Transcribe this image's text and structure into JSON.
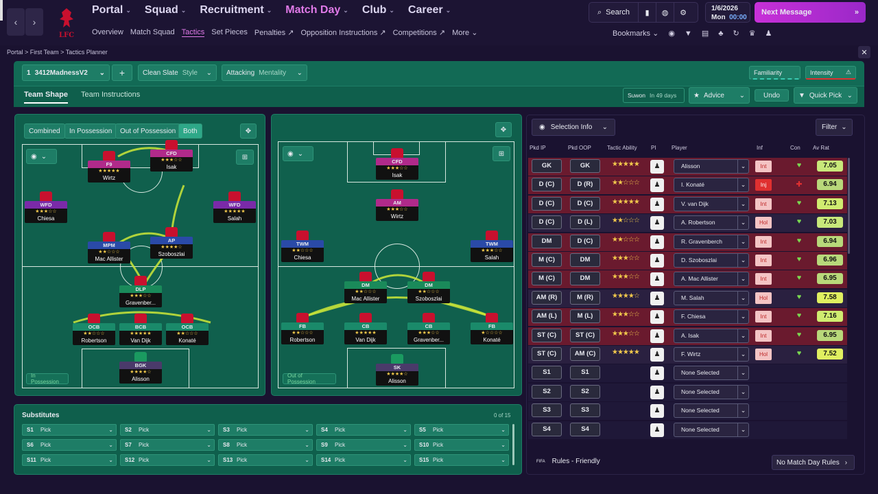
{
  "topbar": {
    "crest_text": "LFC",
    "nav": [
      {
        "label": "Portal",
        "active": false
      },
      {
        "label": "Squad",
        "active": false
      },
      {
        "label": "Recruitment",
        "active": false
      },
      {
        "label": "Match Day",
        "active": true
      },
      {
        "label": "Club",
        "active": false
      },
      {
        "label": "Career",
        "active": false
      }
    ],
    "subnav": [
      "Overview",
      "Match Squad",
      "Tactics",
      "Set Pieces",
      "Penalties",
      "Opposition Instructions",
      "Competitions",
      "More"
    ],
    "search_label": "Search",
    "date": "1/6/2026",
    "day": "Mon",
    "time": "00:00",
    "next_message": "Next Message",
    "bookmarks_label": "Bookmarks"
  },
  "breadcrumb": [
    "Portal",
    "First Team",
    "Tactics Planner"
  ],
  "tactic_bar": {
    "slot": "1",
    "tactic_name": "3412MadnessV2",
    "style_value": "Clean Slate",
    "style_label": "Style",
    "mentality_value": "Attacking",
    "mentality_label": "Mentality",
    "familiarity_label": "Familiarity",
    "intensity_label": "Intensity"
  },
  "tabs": {
    "team_shape": "Team Shape",
    "team_instructions": "Team Instructions",
    "next_match_opponent": "Suwon",
    "next_match_when": "In 49 days",
    "advice": "Advice",
    "undo": "Undo",
    "quick_pick": "Quick Pick"
  },
  "phase_toggle": [
    "Combined",
    "In Possession",
    "Out of Possession",
    "Both"
  ],
  "in_possession_label": "In Possession",
  "out_of_possession_label": "Out of Possession",
  "in_possession": [
    {
      "role": "F9",
      "stars": "★★★★★",
      "name": "Wirtz",
      "color": "#b02a8a"
    },
    {
      "role": "CFD",
      "stars": "★★★☆☆",
      "name": "Isak",
      "color": "#b02a8a"
    },
    {
      "role": "WFD",
      "stars": "★★★☆☆",
      "name": "Chiesa",
      "color": "#7a2aa8"
    },
    {
      "role": "WFD",
      "stars": "★★★★★",
      "name": "Salah",
      "color": "#7a2aa8"
    },
    {
      "role": "MPM",
      "stars": "★★☆☆☆",
      "name": "Mac Allister",
      "color": "#2a4aa8"
    },
    {
      "role": "AP",
      "stars": "★★★★☆",
      "name": "Szoboszlai",
      "color": "#2a4aa8"
    },
    {
      "role": "DLP",
      "stars": "★★★☆☆",
      "name": "Gravenber...",
      "color": "#1a8a5a"
    },
    {
      "role": "OCB",
      "stars": "★★☆☆☆",
      "name": "Robertson",
      "color": "#1a8a6a"
    },
    {
      "role": "BCB",
      "stars": "★★★★★",
      "name": "Van Dijk",
      "color": "#1a8a6a"
    },
    {
      "role": "OCB",
      "stars": "★★☆☆☆",
      "name": "Konaté",
      "color": "#1a8a6a"
    },
    {
      "role": "BGK",
      "stars": "★★★★☆",
      "name": "Alisson",
      "color": "#4a3a6a"
    }
  ],
  "out_of_possession": [
    {
      "role": "CFD",
      "stars": "★★★☆☆",
      "name": "Isak",
      "color": "#b02a8a"
    },
    {
      "role": "AM",
      "stars": "★★★☆☆",
      "name": "Wirtz",
      "color": "#b02a8a"
    },
    {
      "role": "TWM",
      "stars": "★★☆☆☆",
      "name": "Chiesa",
      "color": "#2a4aa8"
    },
    {
      "role": "TWM",
      "stars": "★★★☆☆",
      "name": "Salah",
      "color": "#2a4aa8"
    },
    {
      "role": "DM",
      "stars": "★★☆☆☆",
      "name": "Mac Allister",
      "color": "#1a8a5a"
    },
    {
      "role": "DM",
      "stars": "★★☆☆☆",
      "name": "Szoboszlai",
      "color": "#1a8a5a"
    },
    {
      "role": "FB",
      "stars": "★★☆☆☆",
      "name": "Robertson",
      "color": "#1a8a6a"
    },
    {
      "role": "CB",
      "stars": "★★★★★",
      "name": "Van Dijk",
      "color": "#1a8a6a"
    },
    {
      "role": "CB",
      "stars": "★★★☆☆",
      "name": "Gravenber...",
      "color": "#1a8a6a"
    },
    {
      "role": "FB",
      "stars": "★☆☆☆☆",
      "name": "Konaté",
      "color": "#1a8a6a"
    },
    {
      "role": "SK",
      "stars": "★★★★☆",
      "name": "Alisson",
      "color": "#4a3a6a"
    }
  ],
  "selection": {
    "title": "Selection Info",
    "filter": "Filter",
    "headers": [
      "Pkd IP",
      "Pkd OOP",
      "Tactic Ability",
      "PI",
      "Player",
      "Inf",
      "Con",
      "Av Rat"
    ],
    "rows": [
      {
        "ip": "GK",
        "oop": "GK",
        "stars": "★★★★★",
        "player": "Alisson",
        "inf": "Int",
        "rat": "7.05",
        "bg": "#6a1a2e"
      },
      {
        "ip": "D (C)",
        "oop": "D (R)",
        "stars": "★★☆☆☆",
        "player": "I. Konaté",
        "inf": "Inj",
        "rat": "6.94",
        "bg": "#6a1a2e"
      },
      {
        "ip": "D (C)",
        "oop": "D (C)",
        "stars": "★★★★★",
        "player": "V. van Dijk",
        "inf": "Int",
        "rat": "7.13",
        "bg": "#6a1a2e"
      },
      {
        "ip": "D (C)",
        "oop": "D (L)",
        "stars": "★★☆☆☆",
        "player": "A. Robertson",
        "inf": "Hol",
        "rat": "7.03",
        "bg": "#2a2040"
      },
      {
        "ip": "DM",
        "oop": "D (C)",
        "stars": "★★☆☆☆",
        "player": "R. Gravenberch",
        "inf": "Int",
        "rat": "6.94",
        "bg": "#6a1a2e"
      },
      {
        "ip": "M (C)",
        "oop": "DM",
        "stars": "★★★☆☆",
        "player": "D. Szoboszlai",
        "inf": "Int",
        "rat": "6.96",
        "bg": "#6a1a2e"
      },
      {
        "ip": "M (C)",
        "oop": "DM",
        "stars": "★★★☆☆",
        "player": "A. Mac Allister",
        "inf": "Int",
        "rat": "6.95",
        "bg": "#6a1a2e"
      },
      {
        "ip": "AM (R)",
        "oop": "M (R)",
        "stars": "★★★★☆",
        "player": "M. Salah",
        "inf": "Hol",
        "rat": "7.58",
        "bg": "#2a2040"
      },
      {
        "ip": "AM (L)",
        "oop": "M (L)",
        "stars": "★★★☆☆",
        "player": "F. Chiesa",
        "inf": "Int",
        "rat": "7.16",
        "bg": "#6a1a2e"
      },
      {
        "ip": "ST (C)",
        "oop": "ST (C)",
        "stars": "★★★☆☆",
        "player": "A. Isak",
        "inf": "Int",
        "rat": "6.95",
        "bg": "#6a1a2e"
      },
      {
        "ip": "ST (C)",
        "oop": "AM (C)",
        "stars": "★★★★★",
        "player": "F. Wirtz",
        "inf": "Hol",
        "rat": "7.52",
        "bg": "#2a2040"
      },
      {
        "ip": "S1",
        "oop": "S1",
        "stars": "",
        "player": "None Selected",
        "inf": "",
        "rat": "",
        "bg": "#1f1838"
      },
      {
        "ip": "S2",
        "oop": "S2",
        "stars": "",
        "player": "None Selected",
        "inf": "",
        "rat": "",
        "bg": "#1f1838"
      },
      {
        "ip": "S3",
        "oop": "S3",
        "stars": "",
        "player": "None Selected",
        "inf": "",
        "rat": "",
        "bg": "#1f1838"
      },
      {
        "ip": "S4",
        "oop": "S4",
        "stars": "",
        "player": "None Selected",
        "inf": "",
        "rat": "",
        "bg": "#1f1838"
      }
    ],
    "rules_label": "Rules - Friendly",
    "no_match_day_rules": "No Match Day Rules"
  },
  "substitutes": {
    "title": "Substitutes",
    "count": "0 of 15",
    "slots": [
      "S1",
      "S2",
      "S3",
      "S4",
      "S5",
      "S6",
      "S7",
      "S8",
      "S9",
      "S10",
      "S11",
      "S12",
      "S13",
      "S14",
      "S15"
    ],
    "pick_label": "Pick"
  }
}
